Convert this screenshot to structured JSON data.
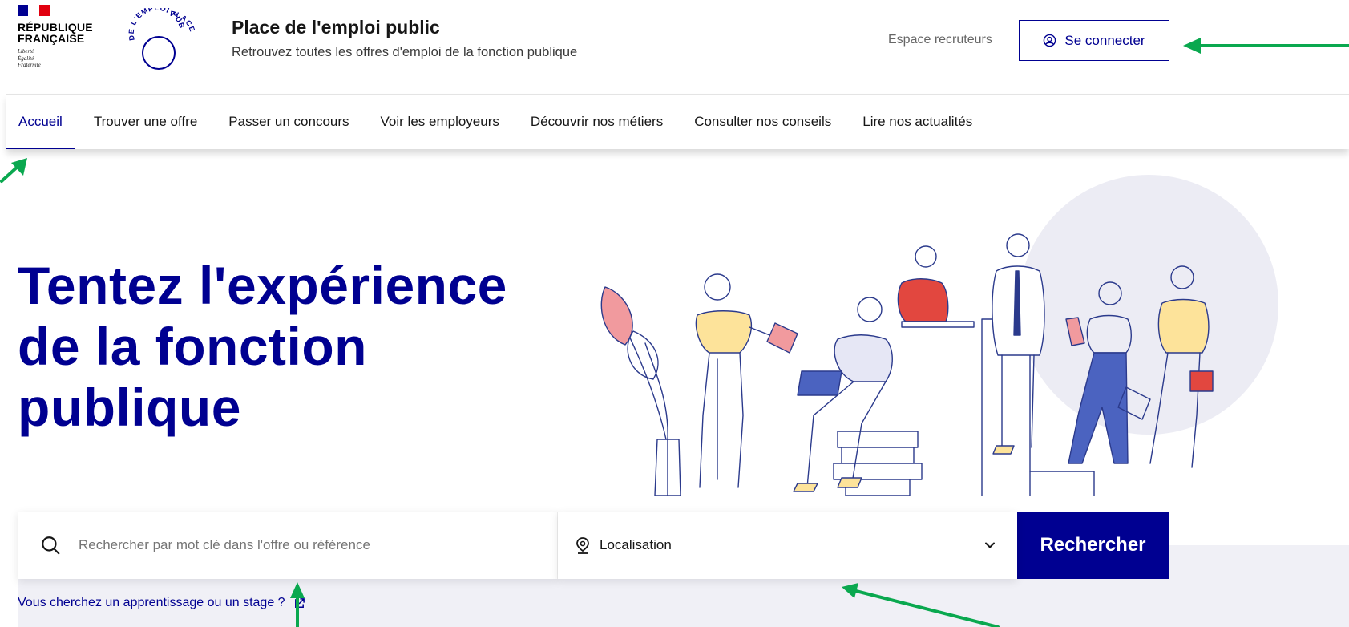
{
  "header": {
    "gov_name_line1": "RÉPUBLIQUE",
    "gov_name_line2": "FRANÇAISE",
    "motto": [
      "Liberté",
      "Égalité",
      "Fraternité"
    ],
    "logo_text_top": "PLACE",
    "logo_text_bottom": "DE L'EMPLOI PUBLIC",
    "site_title": "Place de l'emploi public",
    "site_tagline": "Retrouvez toutes les offres d'emploi de la fonction publique",
    "recruiter_link": "Espace recruteurs",
    "login_button": "Se connecter"
  },
  "nav": {
    "items": [
      {
        "label": "Accueil",
        "active": true
      },
      {
        "label": "Trouver une offre",
        "active": false
      },
      {
        "label": "Passer un concours",
        "active": false
      },
      {
        "label": "Voir les employeurs",
        "active": false
      },
      {
        "label": "Découvrir nos métiers",
        "active": false
      },
      {
        "label": "Consulter nos conseils",
        "active": false
      },
      {
        "label": "Lire nos actualités",
        "active": false
      }
    ]
  },
  "hero": {
    "title_lines": [
      "Tentez l'expérience",
      "de la fonction",
      "publique"
    ]
  },
  "search": {
    "keyword_placeholder": "Rechercher par mot clé dans l'offre ou référence",
    "location_label": "Localisation",
    "submit_label": "Rechercher",
    "internship_link": "Vous cherchez un apprentissage ou un stage ?"
  },
  "colors": {
    "primary": "#000091",
    "flag_blue": "#000091",
    "flag_red": "#e1000f",
    "annotation_arrow": "#0aa84f",
    "illustration_pink": "#f19a9e",
    "illustration_yellow": "#fde39a",
    "illustration_blue": "#4b63c0",
    "illustration_red": "#e2473f"
  },
  "icons": {
    "login": "user-circle-icon",
    "search": "search-icon",
    "location": "location-pin-icon",
    "dropdown": "chevron-down-icon",
    "external": "external-link-icon"
  }
}
